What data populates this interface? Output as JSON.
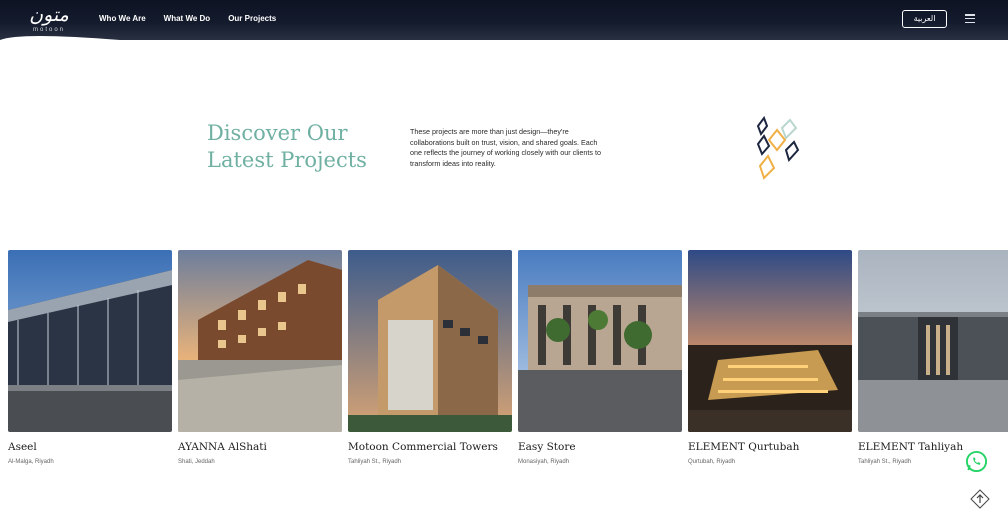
{
  "header": {
    "logo_ar": "متون",
    "logo_en": "motoon",
    "nav": [
      "Who We Are",
      "What We Do",
      "Our Projects"
    ],
    "lang_label": "العربية",
    "menu_icon": "hamburger-icon"
  },
  "intro": {
    "title_line1": "Discover Our",
    "title_line2": "Latest Projects",
    "text": "These projects are more than just design—they're collaborations built on trust, vision, and shared goals. Each one reflects the journey of working closely with our clients to transform ideas into reality."
  },
  "projects": [
    {
      "name": "Aseel",
      "location": "Al-Malga, Riyadh"
    },
    {
      "name": "AYANNA AlShati",
      "location": "Shati, Jeddah"
    },
    {
      "name": "Motoon Commercial Towers",
      "location": "Tahliyah St., Riyadh"
    },
    {
      "name": "Easy Store",
      "location": "Monasiyah, Riyadh"
    },
    {
      "name": "ELEMENT Qurtubah",
      "location": "Qurtubah, Riyadh"
    },
    {
      "name": "ELEMENT Tahliyah",
      "location": "Tahliyah St., Riyadh"
    }
  ],
  "colors": {
    "accent": "#6fb0a2",
    "header_bg": "#0d1322",
    "whatsapp": "#25d366"
  },
  "icons": {
    "whatsapp": "whatsapp-icon",
    "scroll_top": "arrow-up-icon"
  }
}
